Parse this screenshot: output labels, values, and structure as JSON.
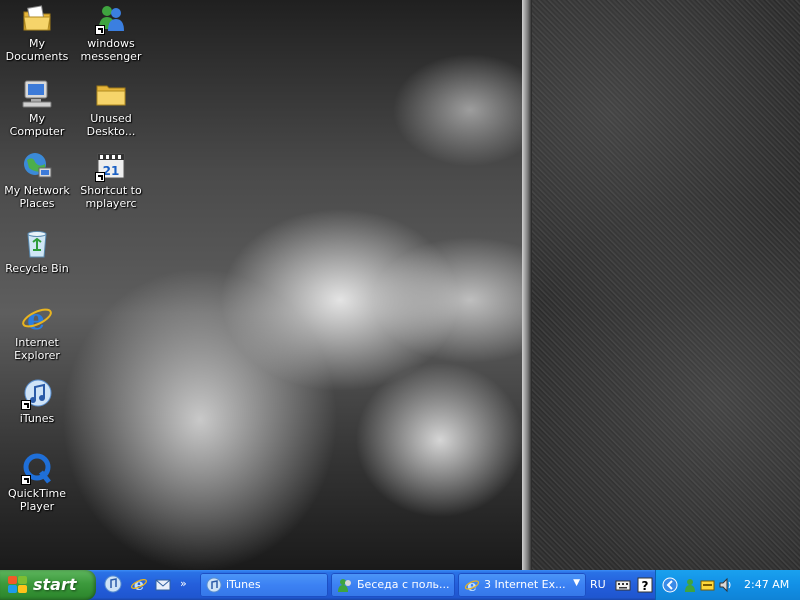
{
  "desktop": {
    "icons": [
      {
        "label": "My Documents",
        "icon": "my-documents-icon"
      },
      {
        "label": "windows messenger",
        "icon": "windows-messenger-icon",
        "shortcut": true
      },
      {
        "label": "My Computer",
        "icon": "my-computer-icon"
      },
      {
        "label": "Unused Deskto...",
        "icon": "folder-icon"
      },
      {
        "label": "My Network Places",
        "icon": "network-places-icon"
      },
      {
        "label": "Shortcut to mplayerc",
        "icon": "mplayerc-icon",
        "shortcut": true
      },
      {
        "label": "Recycle Bin",
        "icon": "recycle-bin-icon"
      },
      {
        "label": "Internet Explorer",
        "icon": "internet-explorer-icon"
      },
      {
        "label": "iTunes",
        "icon": "itunes-icon",
        "shortcut": true
      },
      {
        "label": "QuickTime Player",
        "icon": "quicktime-icon",
        "shortcut": true
      }
    ]
  },
  "taskbar": {
    "start_label": "start",
    "quick_launch": [
      "itunes-quicklaunch-icon",
      "internet-explorer-quicklaunch-icon",
      "outlook-express-quicklaunch-icon"
    ],
    "overflow_chevron": "»",
    "tasks": [
      {
        "label": "iTunes",
        "icon": "itunes-icon"
      },
      {
        "label": "Беседа с поль...",
        "icon": "messenger-conversation-icon"
      },
      {
        "label": "3 Internet Ex...",
        "icon": "internet-explorer-icon",
        "dropdown": true
      }
    ],
    "language": "RU",
    "tray_icons": [
      "keyboard-icon",
      "help-icon",
      "show-hidden-icons-arrow",
      "messenger-status-icon",
      "notification-icon",
      "volume-icon"
    ],
    "clock": "2:47 AM"
  },
  "colors": {
    "taskbar_blue": "#245edb",
    "start_green": "#3c9a3c",
    "tray_blue": "#1290e6"
  }
}
